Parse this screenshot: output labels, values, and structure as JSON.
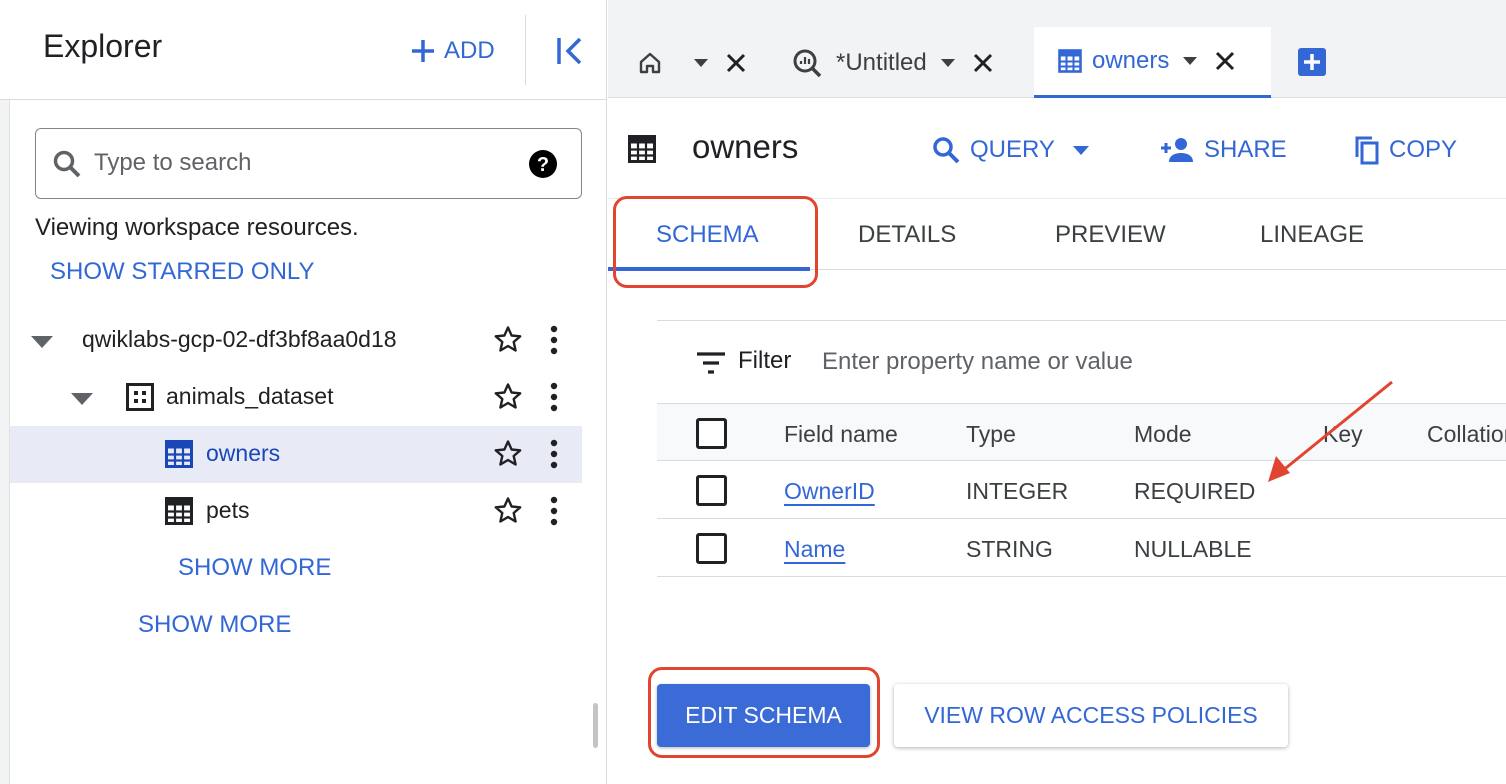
{
  "explorer": {
    "title": "Explorer",
    "add_label": "ADD",
    "search_placeholder": "Type to search",
    "viewing_text": "Viewing workspace resources.",
    "show_starred_label": "SHOW STARRED ONLY",
    "tree": {
      "project": "qwiklabs-gcp-02-df3bf8aa0d18",
      "dataset": "animals_dataset",
      "tables": [
        "owners",
        "pets"
      ],
      "selected_table": "owners",
      "show_more_tables": "SHOW MORE",
      "show_more_datasets": "SHOW MORE"
    }
  },
  "tabs": [
    {
      "icon": "home-icon",
      "label": ""
    },
    {
      "icon": "query-icon",
      "label": "*Untitled"
    },
    {
      "icon": "table-icon",
      "label": "owners",
      "active": true
    }
  ],
  "table_view": {
    "title": "owners",
    "actions": {
      "query": "QUERY",
      "share": "SHARE",
      "copy": "COPY"
    },
    "subtabs": [
      "SCHEMA",
      "DETAILS",
      "PREVIEW",
      "LINEAGE"
    ],
    "active_subtab": "SCHEMA"
  },
  "schema": {
    "filter_label": "Filter",
    "filter_placeholder": "Enter property name or value",
    "columns": [
      "Field name",
      "Type",
      "Mode",
      "Key",
      "Collation"
    ],
    "rows": [
      {
        "field": "OwnerID",
        "type": "INTEGER",
        "mode": "REQUIRED"
      },
      {
        "field": "Name",
        "type": "STRING",
        "mode": "NULLABLE"
      }
    ]
  },
  "buttons": {
    "edit_schema": "EDIT SCHEMA",
    "row_access": "VIEW ROW ACCESS POLICIES"
  },
  "colors": {
    "accent": "#3367d6",
    "highlight": "#e0452f",
    "selected_row": "#e8eaf6"
  }
}
